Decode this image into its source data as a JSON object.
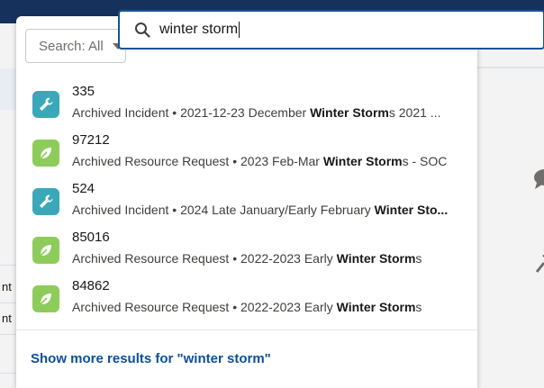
{
  "background": {
    "left_edge_texts": [
      "nt",
      "nt"
    ]
  },
  "search": {
    "scope_label": "Search: All",
    "query": "winter storm"
  },
  "results": [
    {
      "icon": "wrench-icon",
      "icon_color": "#3ba8b9",
      "title": "335",
      "type": "Archived Incident",
      "detail_pre": "2021-12-23 December ",
      "highlight": "Winter Storm",
      "detail_post": "s 2021 ..."
    },
    {
      "icon": "leaf-icon",
      "icon_color": "#8dcc5a",
      "title": "97212",
      "type": "Archived Resource Request",
      "detail_pre": "2023 Feb-Mar ",
      "highlight": "Winter Storm",
      "detail_post": "s - SOC"
    },
    {
      "icon": "wrench-icon",
      "icon_color": "#3ba8b9",
      "title": "524",
      "type": "Archived Incident",
      "detail_pre": "2024 Late January/Early February ",
      "highlight": "Winter Sto...",
      "detail_post": ""
    },
    {
      "icon": "leaf-icon",
      "icon_color": "#8dcc5a",
      "title": "85016",
      "type": "Archived Resource Request",
      "detail_pre": "2022-2023 Early ",
      "highlight": "Winter Storm",
      "detail_post": "s"
    },
    {
      "icon": "leaf-icon",
      "icon_color": "#8dcc5a",
      "title": "84862",
      "type": "Archived Resource Request",
      "detail_pre": "2022-2023 Early ",
      "highlight": "Winter Storm",
      "detail_post": "s"
    }
  ],
  "separator": " • ",
  "show_more": "Show more results for \"winter storm\""
}
